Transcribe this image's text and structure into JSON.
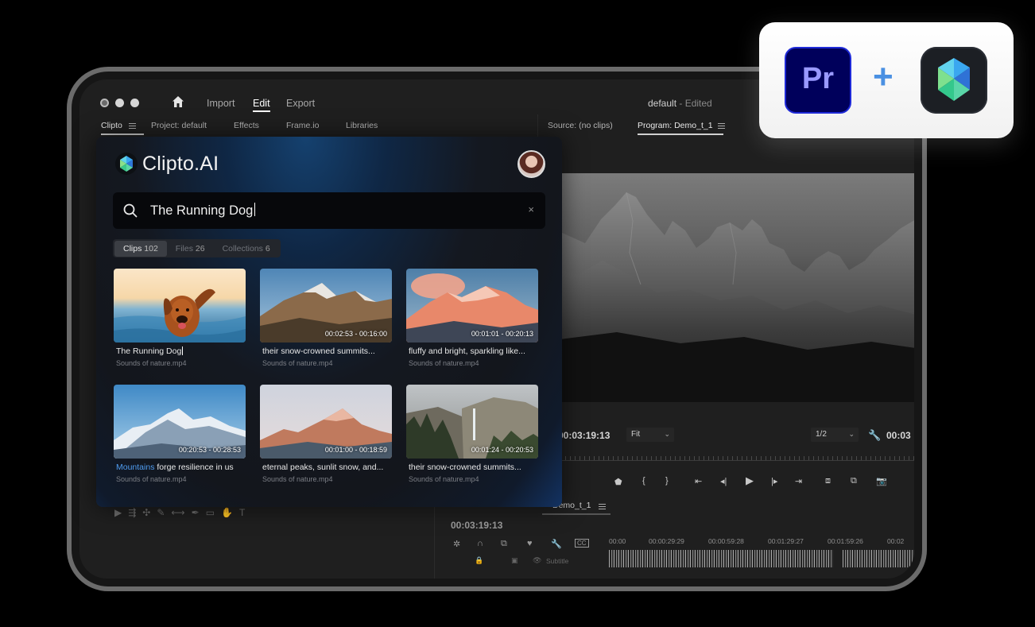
{
  "premiere": {
    "nav": {
      "import": "Import",
      "edit": "Edit",
      "export": "Export"
    },
    "doc_title": "default",
    "doc_status": " - Edited",
    "left_tabs": [
      "Clipto",
      "Project: default",
      "Effects",
      "Frame.io",
      "Libraries"
    ],
    "source_tab": "Source: (no clips)",
    "program_tab": "Program: Demo_t_1",
    "program_timecode": "00:03:19:13",
    "fit_label": "Fit",
    "resolution_label": "1/2",
    "program_end_timecode": "00:03",
    "sequence_tab": "Demo_t_1",
    "timeline_timecode": "00:03:19:13",
    "timeline_ruler": [
      "00:00",
      "00:00:29:29",
      "00:00:59:28",
      "00:01:29:27",
      "00:01:59:26",
      "00:02"
    ],
    "subtitle_label": "Subtitle",
    "cc_label": "CC"
  },
  "clipto": {
    "app_name": "Clipto.AI",
    "search_value": "The Running Dog",
    "clear_glyph": "×",
    "tabs": [
      {
        "label": "Clips",
        "count": "102",
        "active": true
      },
      {
        "label": "Files",
        "count": "26",
        "active": false
      },
      {
        "label": "Collections",
        "count": "6",
        "active": false
      }
    ],
    "results": [
      {
        "time": "",
        "title": "The Running Dog",
        "source": "Sounds of nature.mp4"
      },
      {
        "time": "00:02:53 - 00:16:00",
        "title": "their snow-crowned summits...",
        "source": "Sounds of nature.mp4"
      },
      {
        "time": "00:01:01 - 00:20:13",
        "title": "fluffy and bright, sparkling like...",
        "source": "Sounds of nature.mp4"
      },
      {
        "time": "00:20:53 - 00:28:53",
        "title_highlight": "Mountains",
        "title_rest": " forge resilience in us",
        "source": "Sounds of nature.mp4"
      },
      {
        "time": "00:01:00 - 00:18:59",
        "title": "eternal peaks, sunlit snow, and...",
        "source": "Sounds of nature.mp4"
      },
      {
        "time": "00:01:24 - 00:20:53",
        "title": "their snow-crowned summits...",
        "source": "Sounds of nature.mp4"
      }
    ]
  },
  "badge": {
    "premiere_logo_text": "Pr",
    "plus": "+"
  },
  "colors": {
    "accent_blue": "#4f9cf0",
    "premiere_purple": "#9999ff",
    "premiere_bg": "#00005b"
  }
}
